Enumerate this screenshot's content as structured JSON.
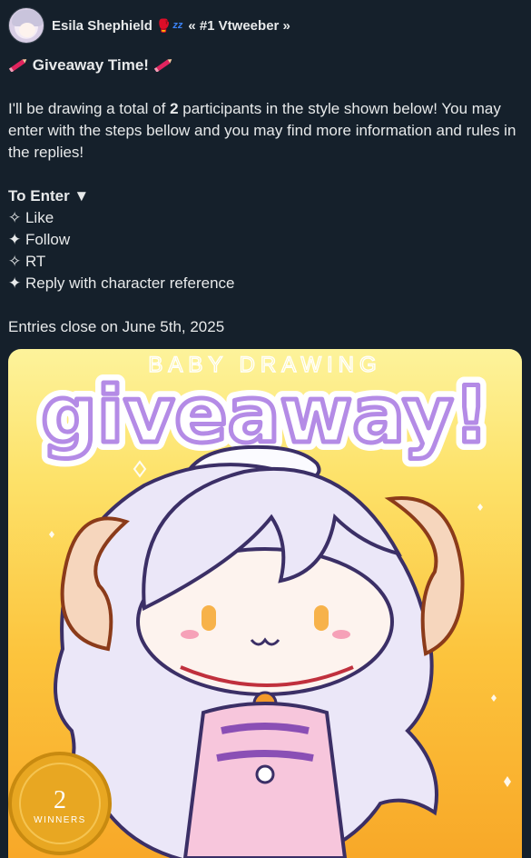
{
  "author": {
    "name": "Esila Shephield",
    "emoji": "🥊",
    "zz": "zz",
    "tagline": "« #1 Vtweeber »"
  },
  "post": {
    "heading": "Giveaway Time!",
    "para1_pre": "I'll be drawing a total of ",
    "para1_bold": "2",
    "para1_post": " participants in the style shown below! You may enter with the steps bellow and you may find more information and rules in the replies!",
    "enter_title": "To Enter ▼",
    "steps": [
      "✧ Like",
      "✦ Follow",
      "✧ RT",
      "✦ Reply with character reference"
    ],
    "closing": "Entries close on June 5th, 2025"
  },
  "image": {
    "top_text": "BABY DRAWING",
    "main_text": "giveaway!",
    "badge_number": "2",
    "badge_label": "WINNERS"
  },
  "colors": {
    "background": "#15202b",
    "text": "#e7e9ea",
    "accent_purple": "#b48be6",
    "pencil": "#e0245e"
  }
}
